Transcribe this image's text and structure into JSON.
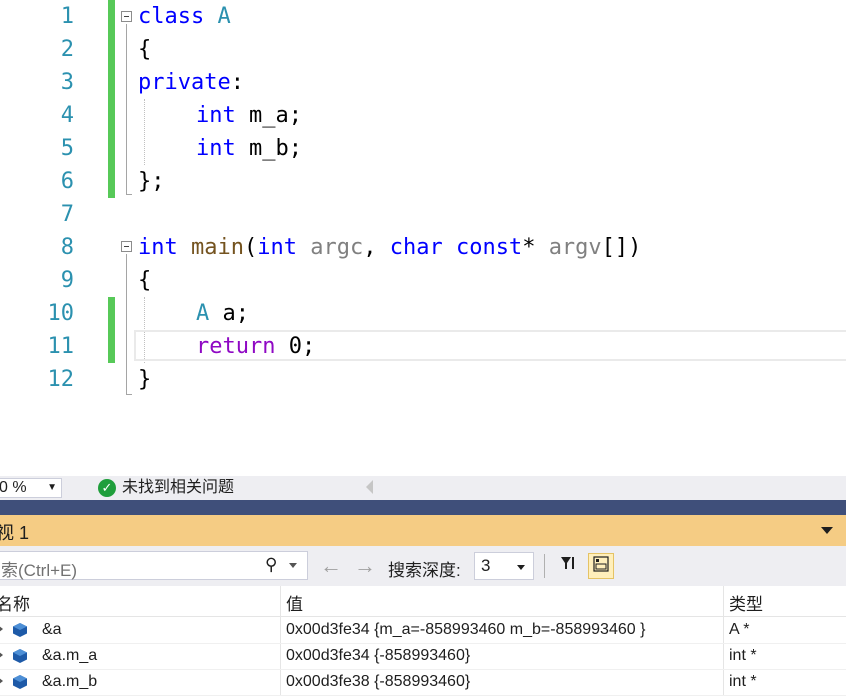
{
  "editor": {
    "lines": [
      {
        "num": "1"
      },
      {
        "num": "2"
      },
      {
        "num": "3"
      },
      {
        "num": "4"
      },
      {
        "num": "5"
      },
      {
        "num": "6"
      },
      {
        "num": "7"
      },
      {
        "num": "8"
      },
      {
        "num": "9"
      },
      {
        "num": "10"
      },
      {
        "num": "11"
      },
      {
        "num": "12"
      }
    ],
    "tokens": {
      "kw_class": "class",
      "cls_A": "A",
      "brace_open": "{",
      "kw_private": "private",
      "colon": ":",
      "kw_int1": "int",
      "m_a": "m_a;",
      "kw_int2": "int",
      "m_b": "m_b;",
      "brace_close_semi": "};",
      "kw_int_main": "int",
      "fn_main": "main",
      "paren_open": "(",
      "kw_int_arg": "int",
      "argc": "argc",
      "comma": ",",
      "kw_char": "char",
      "kw_const": "const",
      "star": "*",
      "argv": "argv",
      "brackets_close": "[])",
      "brace_open2": "{",
      "type_A": "A",
      "var_a": "a;",
      "kw_return": "return",
      "zero": "0;",
      "brace_close2": "}"
    }
  },
  "statusbar": {
    "zoom": "0 %",
    "issues": "未找到相关问题"
  },
  "watch": {
    "title": "视 1",
    "search_placeholder": "索(Ctrl+E)",
    "depth_label": "搜索深度:",
    "depth_value": "3",
    "columns": {
      "name": "名称",
      "value": "值",
      "type": "类型"
    },
    "rows": [
      {
        "name": "&a",
        "value": "0x00d3fe34 {m_a=-858993460 m_b=-858993460 }",
        "type": "A *"
      },
      {
        "name": "&a.m_a",
        "value": "0x00d3fe34 {-858993460}",
        "type": "int *"
      },
      {
        "name": "&a.m_b",
        "value": "0x00d3fe38 {-858993460}",
        "type": "int *"
      }
    ]
  },
  "colors": {
    "line_number": "#2b91af",
    "keyword": "#0000ff",
    "control_keyword": "#8f08c4",
    "change_bar": "#57c958",
    "panel_header": "#f5cc84",
    "separator": "#3f4f7a"
  }
}
